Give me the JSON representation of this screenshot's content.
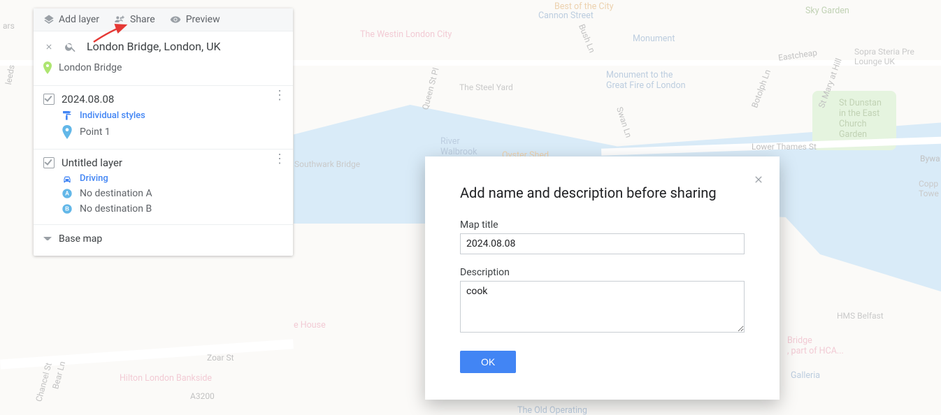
{
  "toolbar": {
    "add_layer": "Add layer",
    "share": "Share",
    "preview": "Preview"
  },
  "search": {
    "query": "London Bridge, London, UK",
    "result": "London Bridge"
  },
  "layers": [
    {
      "name": "2024.08.08",
      "checked": true,
      "style_label": "Individual styles",
      "items": [
        {
          "icon": "point",
          "label": "Point 1"
        }
      ]
    },
    {
      "name": "Untitled layer",
      "checked": true,
      "style_label": "Driving",
      "items": [
        {
          "icon": "letter-a",
          "label": "No destination A"
        },
        {
          "icon": "letter-b",
          "label": "No destination B"
        }
      ]
    }
  ],
  "basemap_label": "Base map",
  "modal": {
    "title": "Add name and description before sharing",
    "map_title_label": "Map title",
    "map_title_value": "2024.08.08",
    "description_label": "Description",
    "description_value": "cook",
    "ok": "OK"
  },
  "map_labels": {
    "cannon_st": "Cannon Street",
    "westin": "The Westin London City",
    "monument": "Monument",
    "monument_fire": "Monument to the\nGreat Fire of London",
    "sky_garden": "Sky Garden",
    "sopra": "Sopra Steria Pre\nLounge UK",
    "eastcheap": "Eastcheap",
    "st_dunstan": "St Dunstan\nin the East\nChurch\nGarden",
    "lower_thames": "Lower Thames St",
    "steel_yard": "The Steel Yard",
    "walbrook": "River\nWalbrook",
    "oyster": "Oyster Shed",
    "southwark_br": "Southwark Bridge",
    "zoar": "Zoar St",
    "a3200": "A3200",
    "hilton": "Hilton London Bankside",
    "opera_house": "e House",
    "old_operating": "The Old Operating",
    "hms_belfast": "HMS Belfast",
    "bridge_hca": "Bridge\n, part of HCA...",
    "galleria": "Galleria",
    "copp_tower": "Copp\nTowe",
    "bush_ln": "Bush Ln",
    "swan_ln": "Swan Ln",
    "botolph_ln": "Botolph Ln",
    "mary_hill": "St Mary at Hill",
    "queen_st": "Queen St Pl",
    "leeds": "leeds",
    "ars": "ars",
    "bywa": "Bywa",
    "bear_ln": "Bear Ln",
    "chancel": "Chancel St",
    "best_city": "Best of the City"
  }
}
